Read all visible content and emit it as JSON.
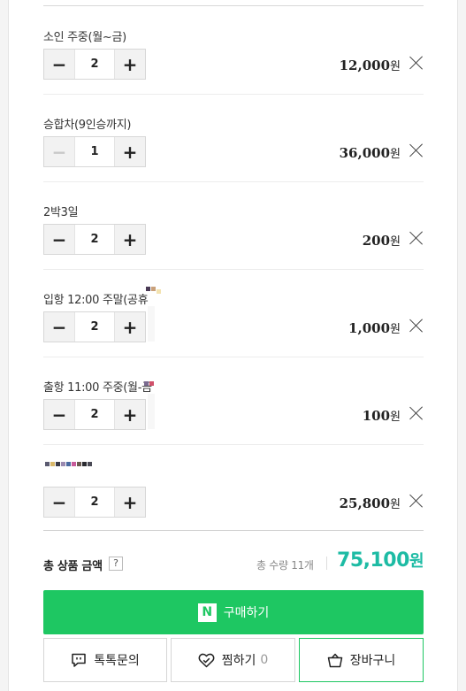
{
  "items": [
    {
      "name": "소인 주중(월~금)",
      "qty": "2",
      "price": "12,000",
      "won": "원"
    },
    {
      "name": "승합차(9인승까지)",
      "qty": "1",
      "price": "36,000",
      "won": "원"
    },
    {
      "name": "2박3일",
      "qty": "2",
      "price": "200",
      "won": "원"
    },
    {
      "name": "입항 12:00 주말(공휴",
      "qty": "2",
      "price": "1,000",
      "won": "원"
    },
    {
      "name": "출항 11:00 주중(월-금",
      "qty": "2",
      "price": "100",
      "won": "원"
    },
    {
      "name": "",
      "qty": "2",
      "price": "25,800",
      "won": "원"
    }
  ],
  "stepper": {
    "minus": "−",
    "plus": "+"
  },
  "total": {
    "label": "총 상품 금액",
    "help": "?",
    "qty_label": "총 수량",
    "qty_value": "11개",
    "price": "75,100",
    "won": "원"
  },
  "buttons": {
    "buy_logo": "N",
    "buy": "구매하기",
    "talk": "톡톡문의",
    "zzim": "찜하기",
    "zzim_count": "0",
    "cart": "장바구니"
  },
  "colors": {
    "accent_green": "#1ec762",
    "total_teal": "#1dbba4"
  },
  "icons": {
    "talk": "chat-bubble-icon",
    "zzim": "heart-check-icon",
    "cart": "shopping-bag-icon",
    "remove": "close-icon"
  }
}
